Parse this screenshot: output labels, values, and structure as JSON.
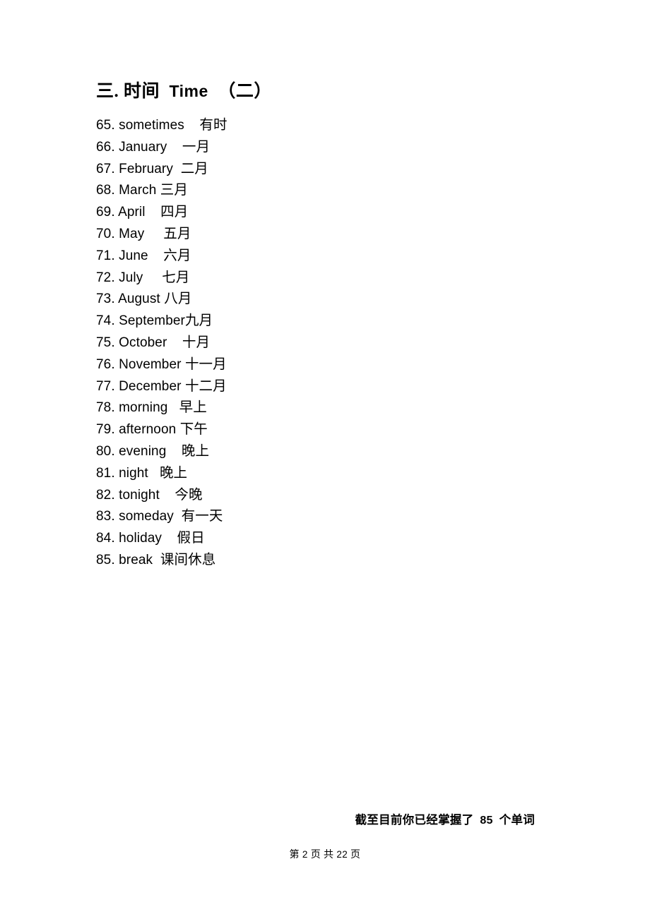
{
  "document": {
    "background_color": "#ffffff",
    "text_color": "#000000"
  },
  "heading": {
    "prefix": "三.",
    "title_zh": "时间",
    "title_en": "Time",
    "part": "（二）",
    "full": "三. 时间 Time （二）"
  },
  "vocab": {
    "items": [
      {
        "num": "65.",
        "en": "sometimes",
        "gap": "    ",
        "zh": "有时"
      },
      {
        "num": "66.",
        "en": "January",
        "gap": "    ",
        "zh": "一月"
      },
      {
        "num": "67.",
        "en": "February",
        "gap": "  ",
        "zh": "二月"
      },
      {
        "num": "68.",
        "en": "March",
        "gap": " ",
        "zh": "三月"
      },
      {
        "num": "69.",
        "en": "April",
        "gap": "    ",
        "zh": "四月"
      },
      {
        "num": "70.",
        "en": "May",
        "gap": "     ",
        "zh": "五月"
      },
      {
        "num": "71.",
        "en": "June",
        "gap": "    ",
        "zh": "六月"
      },
      {
        "num": "72.",
        "en": "July",
        "gap": "     ",
        "zh": "七月"
      },
      {
        "num": "73.",
        "en": "August",
        "gap": " ",
        "zh": "八月"
      },
      {
        "num": "74.",
        "en": "September",
        "gap": "",
        "zh": "九月"
      },
      {
        "num": "75.",
        "en": "October",
        "gap": "    ",
        "zh": "十月"
      },
      {
        "num": "76.",
        "en": "November",
        "gap": " ",
        "zh": "十一月"
      },
      {
        "num": "77.",
        "en": "December",
        "gap": " ",
        "zh": "十二月"
      },
      {
        "num": "78.",
        "en": "morning",
        "gap": "   ",
        "zh": "早上"
      },
      {
        "num": "79.",
        "en": "afternoon",
        "gap": " ",
        "zh": "下午"
      },
      {
        "num": "80.",
        "en": "evening",
        "gap": "    ",
        "zh": "晚上"
      },
      {
        "num": "81.",
        "en": "night",
        "gap": "   ",
        "zh": "晚上"
      },
      {
        "num": "82.",
        "en": "tonight",
        "gap": "    ",
        "zh": "今晚"
      },
      {
        "num": "83.",
        "en": "someday",
        "gap": "  ",
        "zh": "有一天"
      },
      {
        "num": "84.",
        "en": "holiday",
        "gap": "    ",
        "zh": "假日"
      },
      {
        "num": "85.",
        "en": "break",
        "gap": "  ",
        "zh": "课间休息"
      }
    ]
  },
  "mastery_note": {
    "prefix": "截至目前你已经掌握了",
    "count": "85",
    "suffix": "个单词",
    "full": "截至目前你已经掌握了 85 个单词"
  },
  "page_footer": {
    "label_first": "第",
    "current_page": "2",
    "label_page": "页",
    "label_total": "共",
    "total_pages": "22",
    "label_page2": "页",
    "full": "第 2 页 共 22 页"
  }
}
